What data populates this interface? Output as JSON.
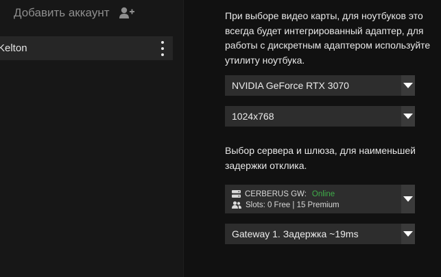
{
  "sidebar": {
    "add_account_label": "Добавить аккаунт",
    "add_account_icon": "add-user-icon",
    "accounts": [
      {
        "name": "Kelton",
        "menu_icon": "more-vertical-icon"
      }
    ]
  },
  "settings": {
    "gpu_note": "При выборе видео карты, для ноутбуков это всегда будет интегрированный адаптер, для работы с дискретным адаптером используйте утилиту ноутбука.",
    "gpu_select": {
      "value": "NVIDIA GeForce RTX 3070",
      "icon": "dropdown-arrow-icon"
    },
    "resolution_select": {
      "value": "1024x768",
      "icon": "dropdown-arrow-icon"
    },
    "server_note": "Выбор сервера и шлюза, для наименьшей задержки отклика.",
    "server_select": {
      "name": "CERBERUS GW:",
      "status": "Online",
      "status_color": "#3fae49",
      "slots": "Slots: 0 Free | 15 Premium",
      "server_icon": "server-icon",
      "users_icon": "users-icon",
      "icon": "dropdown-arrow-icon"
    },
    "gateway_select": {
      "value": "Gateway 1. Задержка ~19ms",
      "icon": "dropdown-arrow-icon"
    }
  }
}
